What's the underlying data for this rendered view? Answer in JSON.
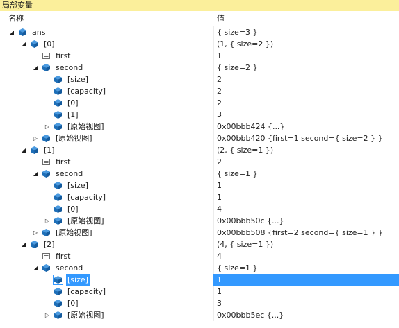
{
  "window": {
    "title": "局部变量"
  },
  "columns": {
    "name": "名称",
    "value": "值"
  },
  "rows": [
    {
      "depth": 0,
      "expander": "expanded",
      "icon": "object-icon",
      "name": "ans",
      "value": "{ size=3 }"
    },
    {
      "depth": 1,
      "expander": "expanded",
      "icon": "object-icon",
      "name": "[0]",
      "value": "(1, { size=2 })"
    },
    {
      "depth": 2,
      "expander": "none",
      "icon": "field-icon",
      "name": "first",
      "value": "1"
    },
    {
      "depth": 2,
      "expander": "expanded",
      "icon": "object-icon",
      "name": "second",
      "value": "{ size=2 }"
    },
    {
      "depth": 3,
      "expander": "none",
      "icon": "object-icon",
      "name": "[size]",
      "value": "2"
    },
    {
      "depth": 3,
      "expander": "none",
      "icon": "object-icon",
      "name": "[capacity]",
      "value": "2"
    },
    {
      "depth": 3,
      "expander": "none",
      "icon": "object-icon",
      "name": "[0]",
      "value": "2"
    },
    {
      "depth": 3,
      "expander": "none",
      "icon": "object-icon",
      "name": "[1]",
      "value": "3"
    },
    {
      "depth": 3,
      "expander": "collapsed",
      "icon": "object-icon",
      "name": "[原始视图]",
      "value": "0x00bbb424 {...}"
    },
    {
      "depth": 2,
      "expander": "collapsed",
      "icon": "object-icon",
      "name": "[原始视图]",
      "value": "0x00bbb420 {first=1 second={ size=2 } }"
    },
    {
      "depth": 1,
      "expander": "expanded",
      "icon": "object-icon",
      "name": "[1]",
      "value": "(2, { size=1 })"
    },
    {
      "depth": 2,
      "expander": "none",
      "icon": "field-icon",
      "name": "first",
      "value": "2"
    },
    {
      "depth": 2,
      "expander": "expanded",
      "icon": "object-icon",
      "name": "second",
      "value": "{ size=1 }"
    },
    {
      "depth": 3,
      "expander": "none",
      "icon": "object-icon",
      "name": "[size]",
      "value": "1"
    },
    {
      "depth": 3,
      "expander": "none",
      "icon": "object-icon",
      "name": "[capacity]",
      "value": "1"
    },
    {
      "depth": 3,
      "expander": "none",
      "icon": "object-icon",
      "name": "[0]",
      "value": "4"
    },
    {
      "depth": 3,
      "expander": "collapsed",
      "icon": "object-icon",
      "name": "[原始视图]",
      "value": "0x00bbb50c {...}"
    },
    {
      "depth": 2,
      "expander": "collapsed",
      "icon": "object-icon",
      "name": "[原始视图]",
      "value": "0x00bbb508 {first=2 second={ size=1 } }"
    },
    {
      "depth": 1,
      "expander": "expanded",
      "icon": "object-icon",
      "name": "[2]",
      "value": "(4, { size=1 })"
    },
    {
      "depth": 2,
      "expander": "none",
      "icon": "field-icon",
      "name": "first",
      "value": "4"
    },
    {
      "depth": 2,
      "expander": "expanded",
      "icon": "object-icon",
      "name": "second",
      "value": "{ size=1 }"
    },
    {
      "depth": 3,
      "expander": "none",
      "icon": "object-icon",
      "name": "[size]",
      "value": "1",
      "selected": true
    },
    {
      "depth": 3,
      "expander": "none",
      "icon": "object-icon",
      "name": "[capacity]",
      "value": "1"
    },
    {
      "depth": 3,
      "expander": "none",
      "icon": "object-icon",
      "name": "[0]",
      "value": "3"
    },
    {
      "depth": 3,
      "expander": "collapsed",
      "icon": "object-icon",
      "name": "[原始视图]",
      "value": "0x00bbb5ec {...}"
    }
  ],
  "colors": {
    "title_bar": "#fbef9b",
    "selection": "#3399ff",
    "object_icon": "#1e6fb8"
  }
}
